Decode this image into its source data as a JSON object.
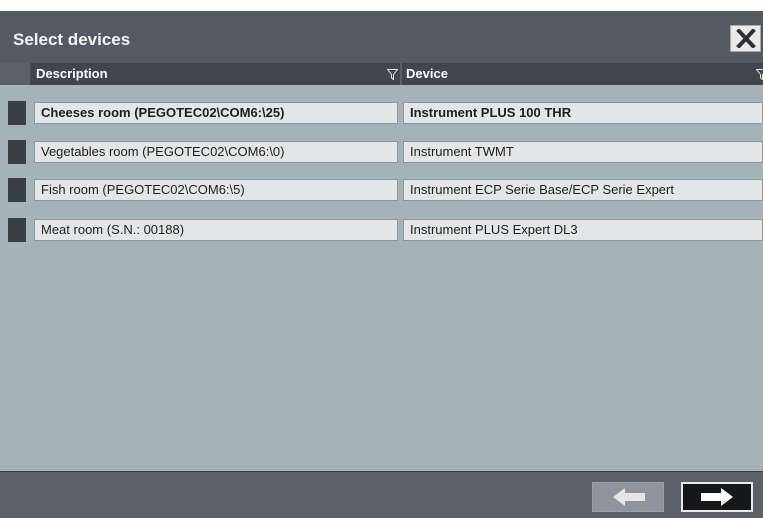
{
  "dialog": {
    "title": "Select devices"
  },
  "columns": {
    "description": "Description",
    "device": "Device"
  },
  "rows": [
    {
      "description": "Cheeses room (PEGOTEC02\\COM6:\\25)",
      "device": "Instrument PLUS 100 THR",
      "selected": true
    },
    {
      "description": "Vegetables room (PEGOTEC02\\COM6:\\0)",
      "device": "Instrument TWMT",
      "selected": false
    },
    {
      "description": "Fish room (PEGOTEC02\\COM6:\\5)",
      "device": "Instrument ECP Serie Base/ECP Serie Expert",
      "selected": false
    },
    {
      "description": "Meat room (S.N.: 00188)",
      "device": "Instrument PLUS Expert DL3",
      "selected": false
    }
  ],
  "icons": {
    "close": "close-x-icon",
    "filter": "funnel-icon",
    "prev": "arrow-left-icon",
    "next": "arrow-right-icon"
  },
  "colors": {
    "window": "#5b6067",
    "content": "#a6b2ba",
    "cell": "#e3e5e6"
  }
}
